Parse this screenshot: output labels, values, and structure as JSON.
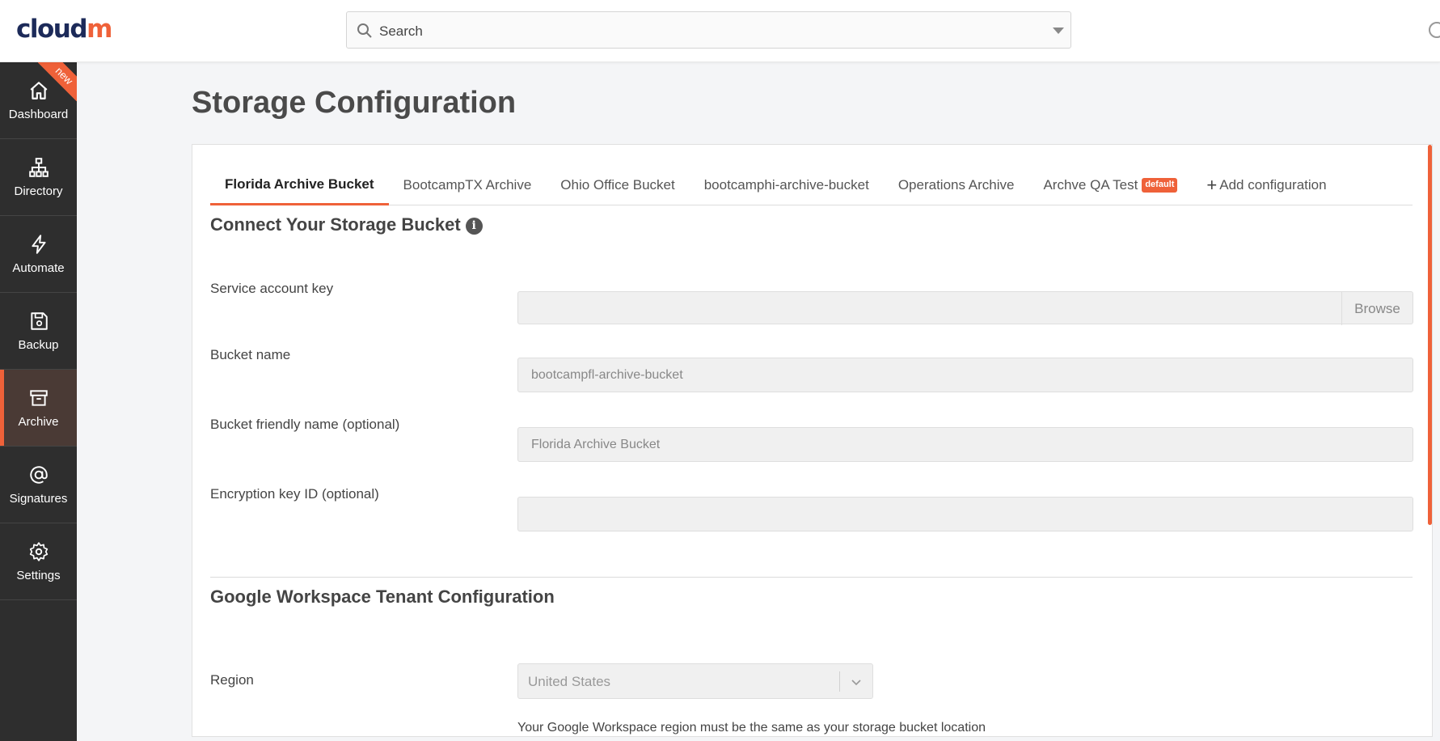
{
  "brand": {
    "logo_main": "cloud",
    "logo_accent": "m",
    "accent_color": "#ef6139"
  },
  "search": {
    "placeholder": "Search"
  },
  "sidebar": {
    "new_ribbon": "new",
    "items": [
      {
        "label": "Dashboard",
        "icon": "home-icon"
      },
      {
        "label": "Directory",
        "icon": "sitemap-icon"
      },
      {
        "label": "Automate",
        "icon": "bolt-icon"
      },
      {
        "label": "Backup",
        "icon": "save-icon"
      },
      {
        "label": "Archive",
        "icon": "archive-icon",
        "active": true
      },
      {
        "label": "Signatures",
        "icon": "at-icon"
      },
      {
        "label": "Settings",
        "icon": "gear-icon"
      }
    ]
  },
  "page": {
    "title": "Storage Configuration"
  },
  "tabs": [
    {
      "label": "Florida Archive Bucket",
      "active": true
    },
    {
      "label": "BootcampTX Archive"
    },
    {
      "label": "Ohio Office Bucket"
    },
    {
      "label": "bootcamphi-archive-bucket"
    },
    {
      "label": "Operations Archive"
    },
    {
      "label": "Archve QA Test",
      "badge": "default"
    },
    {
      "label": "Add configuration",
      "icon": "plus-icon"
    }
  ],
  "bucket_section": {
    "title": "Connect Your Storage Bucket",
    "info_icon": "i",
    "service_account_label": "Service account key",
    "service_account_value": "",
    "browse_label": "Browse",
    "bucket_name_label": "Bucket name",
    "bucket_name_value": "bootcampfl-archive-bucket",
    "friendly_name_label": "Bucket friendly name (optional)",
    "friendly_name_value": "Florida Archive Bucket",
    "encryption_label": "Encryption key ID (optional)",
    "encryption_value": ""
  },
  "tenant_section": {
    "title": "Google Workspace Tenant Configuration",
    "region_label": "Region",
    "region_value": "United States",
    "region_helper": "Your Google Workspace region must be the same as your storage bucket location"
  }
}
